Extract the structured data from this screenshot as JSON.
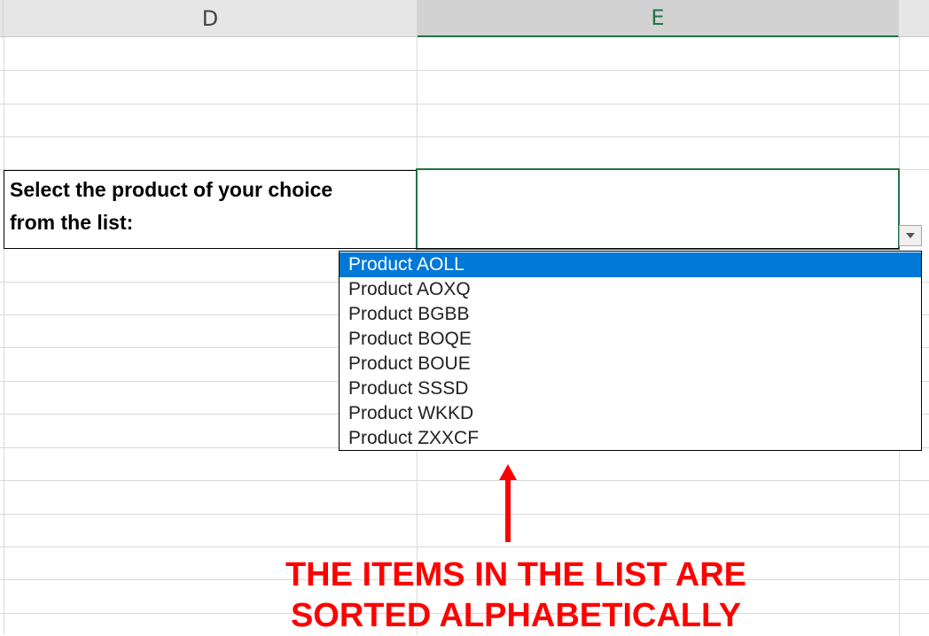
{
  "columns": {
    "d": "D",
    "e": "E"
  },
  "cell_label": {
    "line1": "Select the product of your choice",
    "line2": "from the list:"
  },
  "dropdown": {
    "items": [
      "Product AOLL",
      "Product AOXQ",
      "Product BGBB",
      "Product BOQE",
      "Product BOUE",
      "Product SSSD",
      "Product WKKD",
      "Product ZXXCF"
    ],
    "selected_index": 0
  },
  "annotation": {
    "line1": "THE ITEMS IN THE LIST ARE",
    "line2": "SORTED ALPHABETICALLY",
    "color": "#ff0000"
  },
  "colors": {
    "selection_accent": "#217346",
    "list_highlight": "#0078d7"
  }
}
